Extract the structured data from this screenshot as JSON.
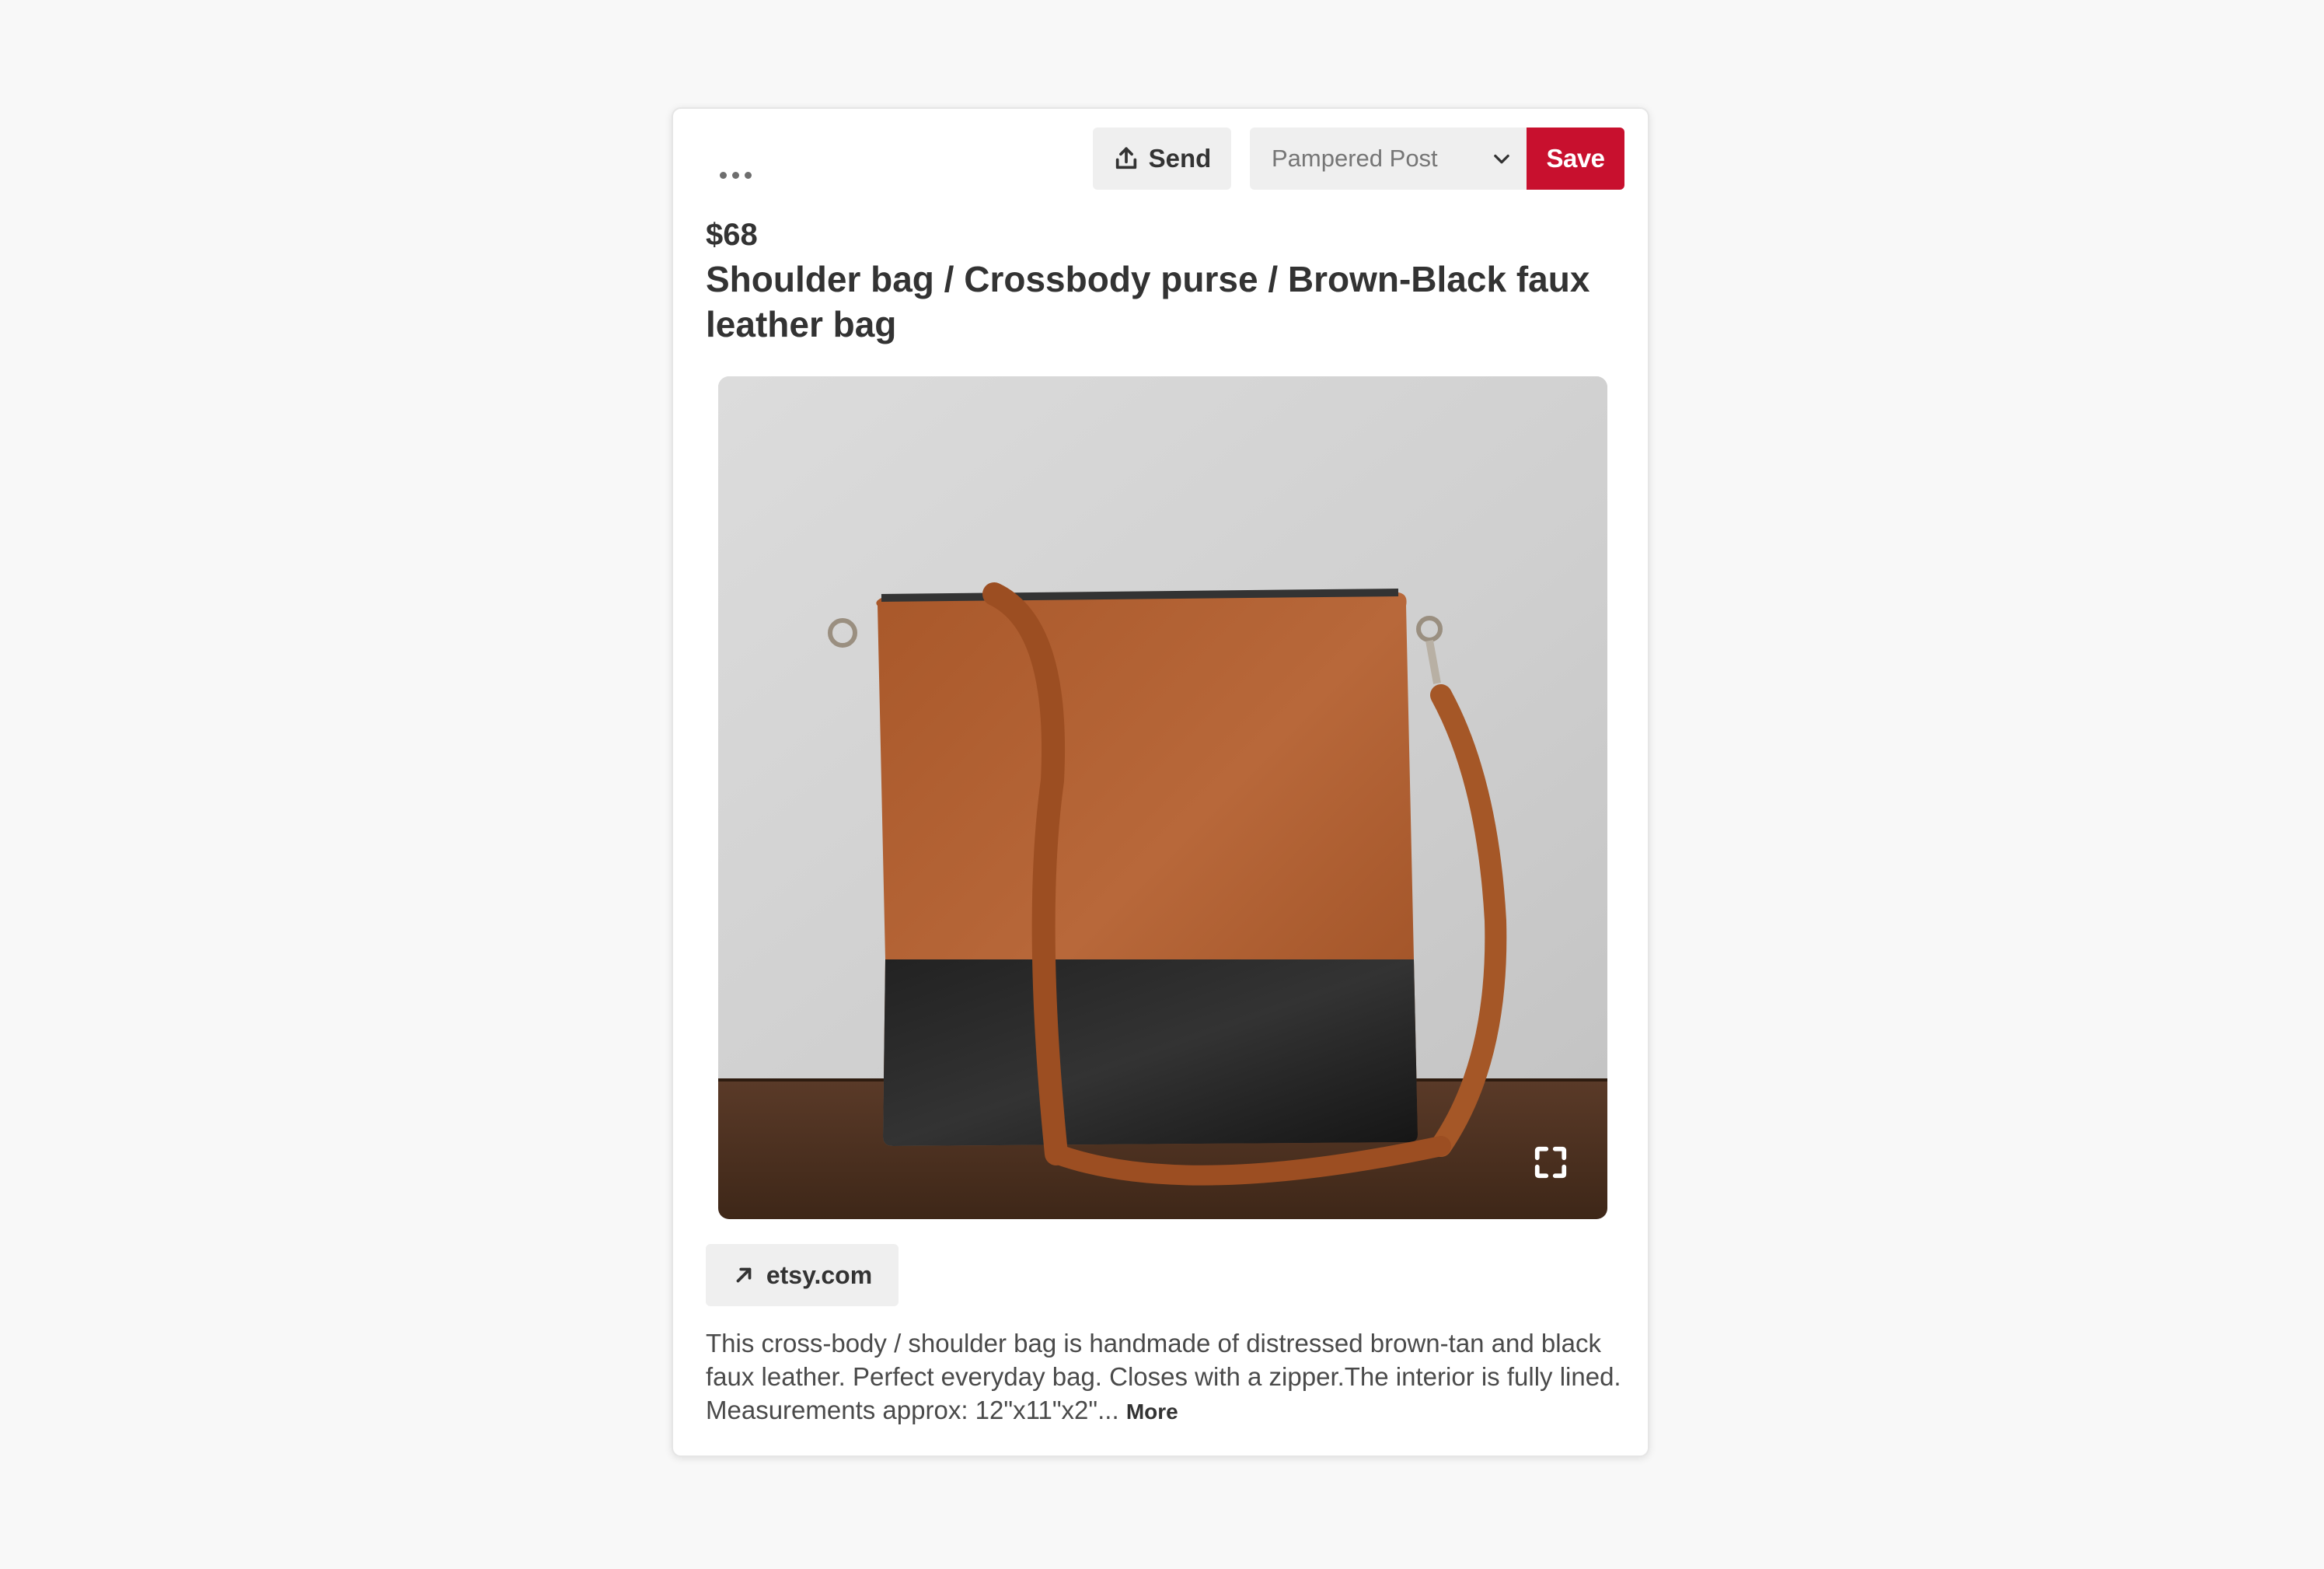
{
  "pin": {
    "more_options_icon": "ellipsis-icon",
    "send": {
      "label": "Send",
      "icon": "share-upload-icon"
    },
    "board_select": {
      "value": "Pampered Post",
      "icon": "chevron-down-icon"
    },
    "save": {
      "label": "Save",
      "color": "#c8102e"
    },
    "price": "$68",
    "title": "Shoulder bag / Crossbody purse / Brown-Black faux leather bag",
    "image": {
      "expand_icon": "expand-icon"
    },
    "source": {
      "label": "etsy.com",
      "icon": "arrow-up-right-icon"
    },
    "description": "This cross-body / shoulder bag is handmade of distressed brown-tan and black faux leather. Perfect everyday bag. Closes with a zipper.The interior is fully lined. Measurements approx: 12\"x11\"x2\"...",
    "more_label": "More"
  }
}
